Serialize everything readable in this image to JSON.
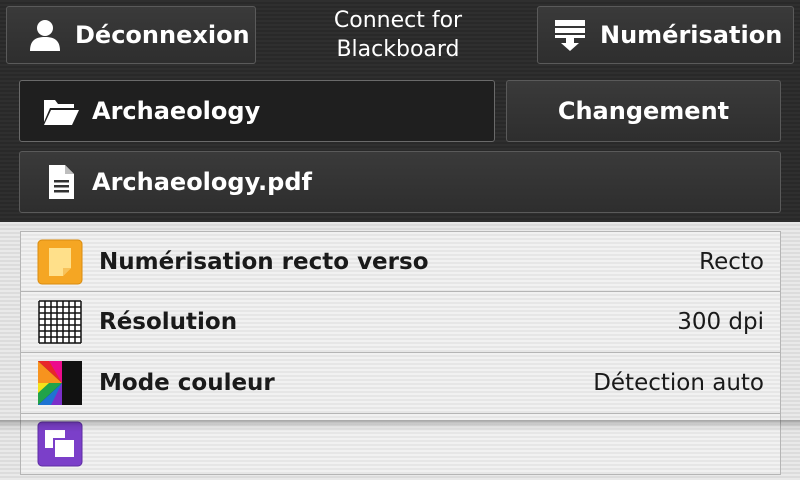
{
  "header": {
    "logout_label": "Déconnexion",
    "app_title_line1": "Connect for",
    "app_title_line2": "Blackboard",
    "scan_label": "Numérisation"
  },
  "location": {
    "folder_label": "Archaeology",
    "change_label": "Changement",
    "file_label": "Archaeology.pdf"
  },
  "settings": [
    {
      "label": "Numérisation recto verso",
      "value": "Recto",
      "icon": "duplex-scan-icon"
    },
    {
      "label": "Résolution",
      "value": "300 dpi",
      "icon": "resolution-grid-icon"
    },
    {
      "label": "Mode couleur",
      "value": "Détection auto",
      "icon": "color-mode-icon"
    },
    {
      "label": "",
      "value": "",
      "icon": "multi-page-icon"
    }
  ],
  "colors": {
    "duplex_icon": "#f5a623",
    "multi_icon": "#7b3fc9",
    "dark_bg": "#2b2b2b",
    "light_bg": "#e9e9e9"
  }
}
